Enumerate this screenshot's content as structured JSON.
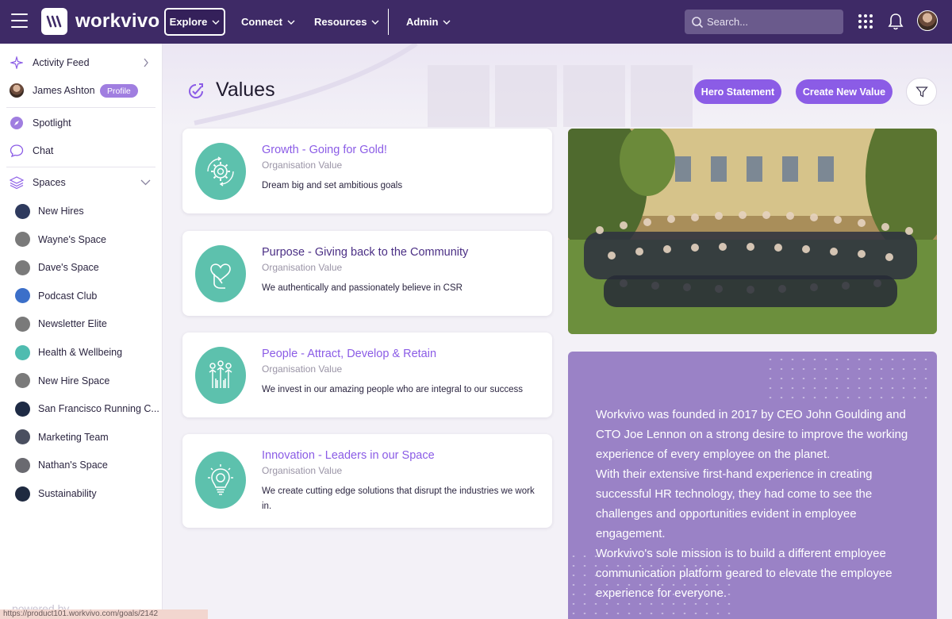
{
  "brand": {
    "name": "workvivo",
    "color_bar": "#3e2a66",
    "accent": "#8b5ce6",
    "teal": "#5dc1ad"
  },
  "topnav": {
    "items": [
      {
        "label": "Explore",
        "active": true
      },
      {
        "label": "Connect"
      },
      {
        "label": "Resources"
      },
      {
        "label": "Admin"
      }
    ],
    "search_placeholder": "Search..."
  },
  "sidebar": {
    "activity_feed": "Activity Feed",
    "user_name": "James Ashton",
    "profile_badge": "Profile",
    "spotlight": "Spotlight",
    "chat": "Chat",
    "spaces_label": "Spaces",
    "spaces": [
      {
        "name": "New Hires",
        "color": "#2e3a5e"
      },
      {
        "name": "Wayne's Space",
        "color": "#7a7a7a"
      },
      {
        "name": "Dave's Space",
        "color": "#7a7a7a"
      },
      {
        "name": "Podcast Club",
        "color": "#3b6fc9"
      },
      {
        "name": "Newsletter Elite",
        "color": "#7a7a7a"
      },
      {
        "name": "Health & Wellbeing",
        "color": "#4fbcb0"
      },
      {
        "name": "New Hire Space",
        "color": "#7a7a7a"
      },
      {
        "name": "San Francisco Running C...",
        "color": "#1e2b45"
      },
      {
        "name": "Marketing Team",
        "color": "#4a4f60"
      },
      {
        "name": "Nathan's Space",
        "color": "#6a6a70"
      },
      {
        "name": "Sustainability",
        "color": "#1f2a40"
      }
    ],
    "powered_by": "powered by",
    "url_tooltip": "https://product101.workvivo.com/goals/2142"
  },
  "page": {
    "title": "Values",
    "hero_button": "Hero Statement",
    "create_button": "Create New Value"
  },
  "values": [
    {
      "title": "Growth - Going for Gold!",
      "subtitle": "Organisation Value",
      "description": "Dream big and set ambitious goals",
      "icon": "gear-cycle-icon"
    },
    {
      "title": "Purpose - Giving back to the Community",
      "subtitle": "Organisation Value",
      "description": "We authentically and passionately believe in CSR",
      "icon": "heart-hand-icon"
    },
    {
      "title": "People - Attract, Develop & Retain",
      "subtitle": "Organisation Value",
      "description": "We invest in our amazing people who are integral to our success",
      "icon": "raised-hands-icon"
    },
    {
      "title": "Innovation - Leaders in our Space",
      "subtitle": "Organisation Value",
      "description": "We create cutting edge solutions that disrupt the industries we work in.",
      "icon": "lightbulb-icon"
    }
  ],
  "about": {
    "p1": "Workvivo was founded in 2017 by CEO John Goulding and CTO Joe Lennon on a strong desire to improve the working experience of every employee on the planet.",
    "p2": "With their extensive first-hand experience in creating successful HR technology, they had come to see the challenges and opportunities evident in employee engagement.",
    "p3": "Workvivo's sole mission is to build a different employee communication platform geared to elevate the employee experience for everyone."
  }
}
